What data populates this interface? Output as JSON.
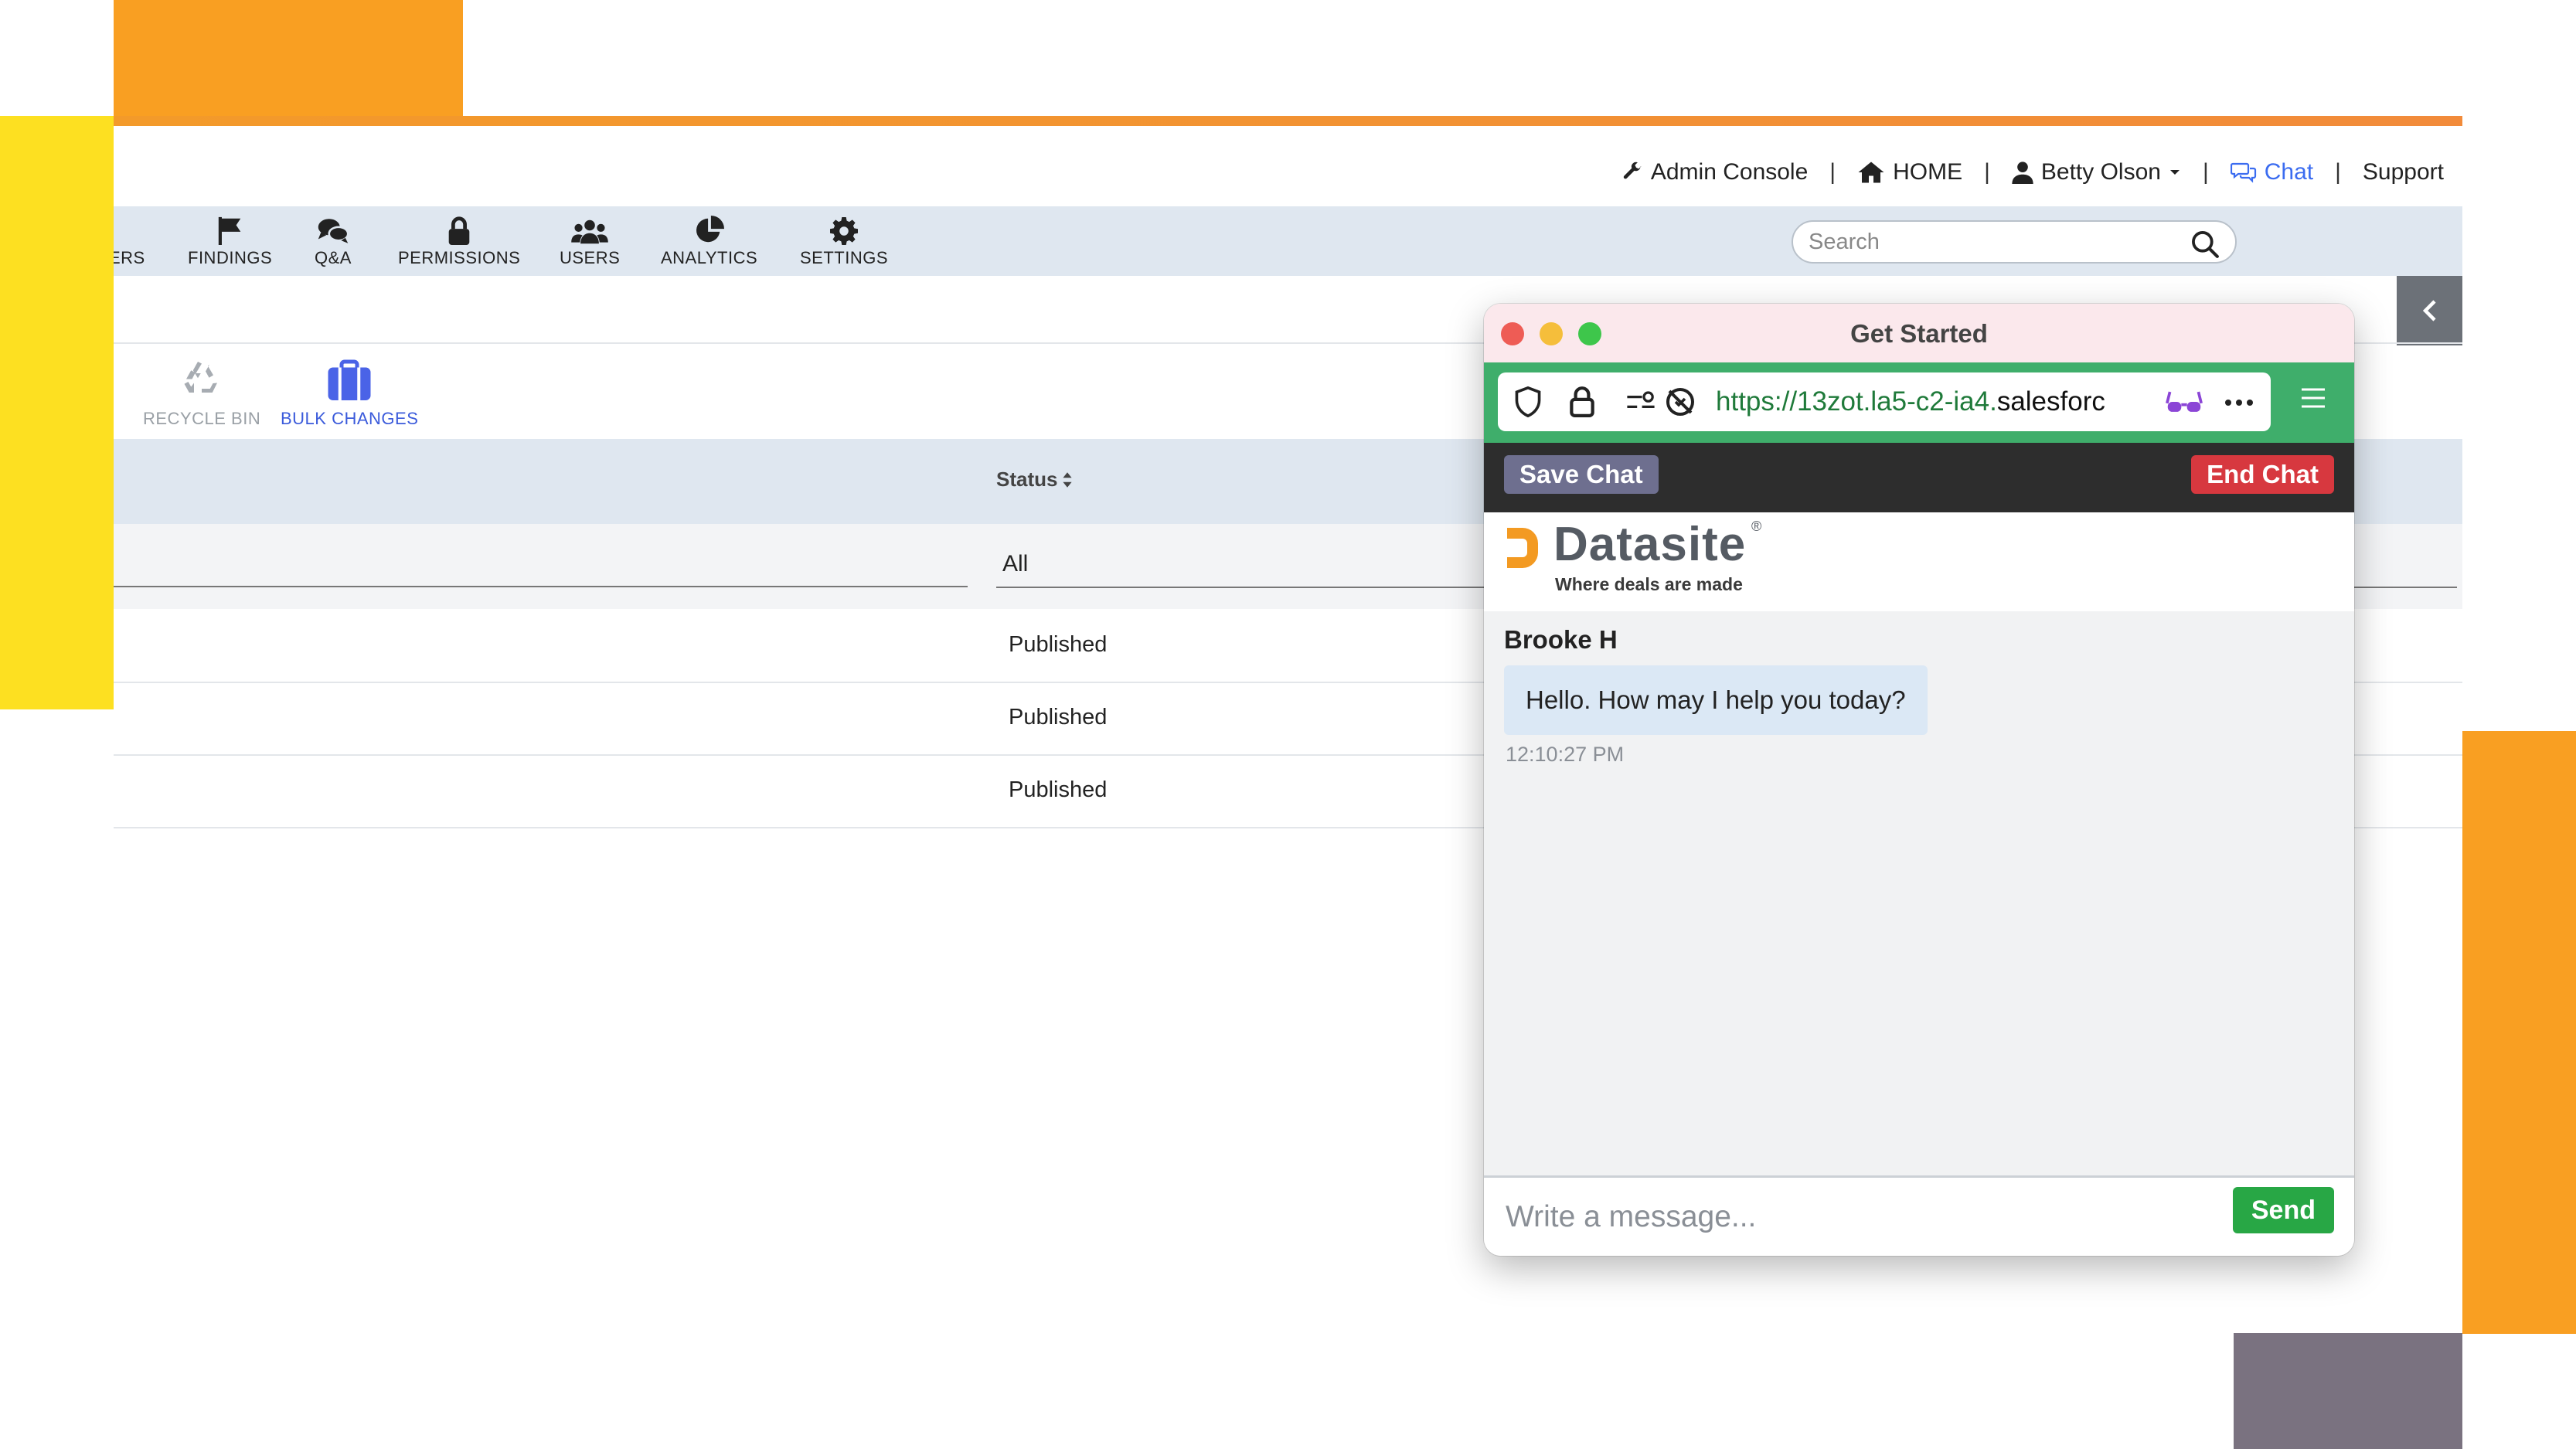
{
  "topnav": {
    "admin_console": "Admin Console",
    "home": "HOME",
    "user_name": "Betty Olson",
    "chat": "Chat",
    "support": "Support",
    "separator": "|"
  },
  "toolbar": {
    "items": [
      {
        "label": "ERS",
        "icon": "folder-icon"
      },
      {
        "label": "FINDINGS",
        "icon": "flag-icon"
      },
      {
        "label": "Q&A",
        "icon": "chat-bubbles-icon"
      },
      {
        "label": "PERMISSIONS",
        "icon": "lock-icon"
      },
      {
        "label": "USERS",
        "icon": "users-icon"
      },
      {
        "label": "ANALYTICS",
        "icon": "pie-chart-icon"
      },
      {
        "label": "SETTINGS",
        "icon": "gear-icon"
      }
    ],
    "search_placeholder": "Search"
  },
  "subtoolbar": {
    "recycle_bin": "RECYCLE BIN",
    "bulk_changes": "BULK CHANGES"
  },
  "table": {
    "status_header": "Status",
    "filter_value": "All",
    "rows": [
      "Published",
      "Published",
      "Published"
    ]
  },
  "chat_window": {
    "title": "Get Started",
    "url_path": "https://13zot.la5-c2-ia4.",
    "url_host": "salesforc",
    "save_chat": "Save Chat",
    "end_chat": "End Chat",
    "brand_name": "Datasite",
    "brand_reg": "®",
    "brand_tagline": "Where deals are made",
    "agent_name": "Brooke H",
    "message": "Hello. How may I help you today?",
    "message_time": "12:10:27 PM",
    "composer_placeholder": "Write a message...",
    "send": "Send"
  },
  "colors": {
    "brand_orange": "#f99f22",
    "brand_yellow": "#fde021",
    "accent_blue": "#3b6cf0",
    "url_green": "#3fae6b",
    "end_red": "#d7383f",
    "send_green": "#28a745"
  }
}
